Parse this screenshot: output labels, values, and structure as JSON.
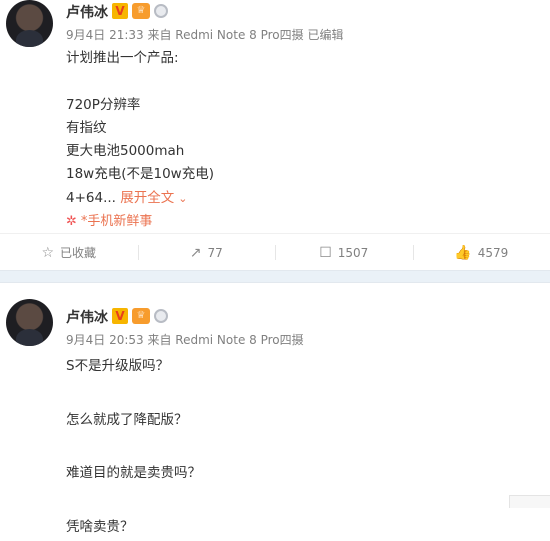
{
  "posts": [
    {
      "author": "卢伟冰",
      "badge_v": "V",
      "badge_crown": "♕",
      "meta": "9月4日 21:33 来自 Redmi Note 8 Pro四摄 已编辑",
      "lines": [
        "计划推出一个产品:",
        "",
        "720P分辨率",
        "有指纹",
        "更大电池5000mah",
        "18w充电(不是10w充电)",
        "4+64..."
      ],
      "expand_label": "展开全文",
      "source_label": "*手机新鲜事",
      "actions": {
        "favorite": "已收藏",
        "repost": "77",
        "comment": "1507",
        "like": "4579"
      }
    },
    {
      "author": "卢伟冰",
      "badge_v": "V",
      "badge_crown": "♕",
      "meta": "9月4日 20:53 来自 Redmi Note 8 Pro四摄",
      "lines": [
        "S不是升级版吗？",
        "",
        "怎么就成了降配版？",
        "",
        "难道目的就是卖贵吗？",
        "",
        "凭啥卖贵？"
      ]
    }
  ],
  "icons": {
    "favorite": "☆",
    "repost": "↗",
    "comment": "☐",
    "like": "👍",
    "chevron": "⌄",
    "source": "✲"
  },
  "colors": {
    "accent": "#eb7350",
    "divider": "#eaf1f7",
    "meta": "#808080"
  }
}
